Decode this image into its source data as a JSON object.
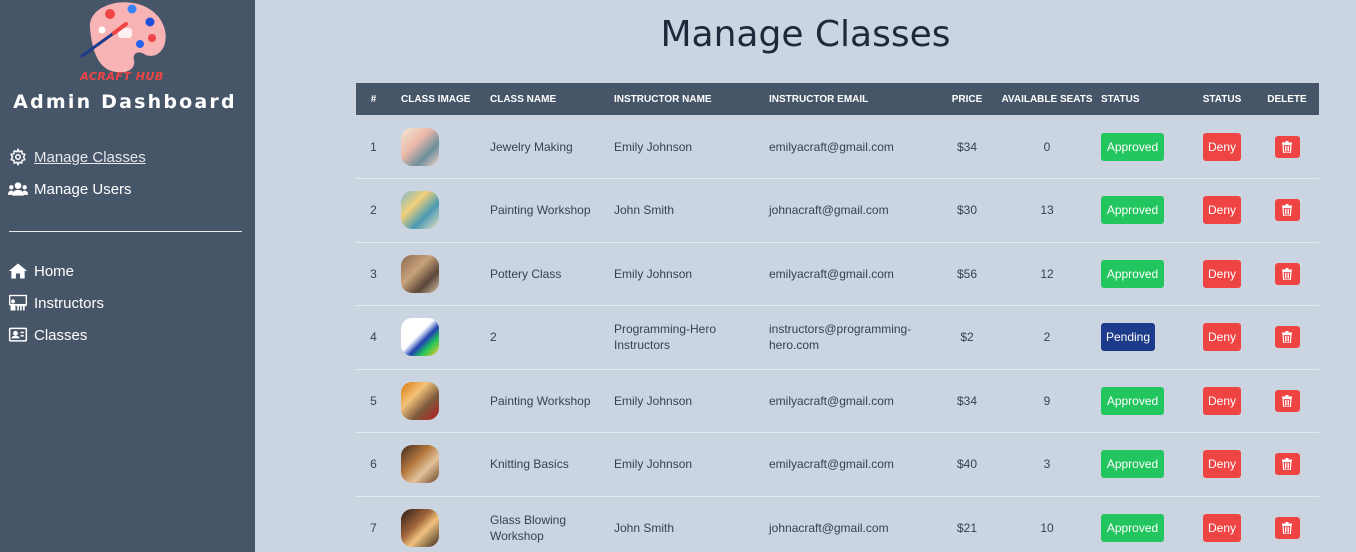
{
  "sidebar": {
    "logo_text": "ACRAFT HUB",
    "title": "Admin Dashboard",
    "primary_nav": [
      {
        "label": "Manage Classes",
        "icon": "gear-icon",
        "active": true
      },
      {
        "label": "Manage Users",
        "icon": "users-icon",
        "active": false
      }
    ],
    "secondary_nav": [
      {
        "label": "Home",
        "icon": "home-icon"
      },
      {
        "label": "Instructors",
        "icon": "instructors-icon"
      },
      {
        "label": "Classes",
        "icon": "classes-icon"
      }
    ]
  },
  "main": {
    "title": "Manage Classes",
    "table": {
      "headers": {
        "num": "#",
        "image": "CLASS IMAGE",
        "name": "CLASS NAME",
        "instructor": "INSTRUCTOR NAME",
        "email": "INSTRUCTOR EMAIL",
        "price": "PRICE",
        "seats": "AVAILABLE SEATS",
        "status": "STATUS",
        "status2": "STATUS",
        "delete": "DELETE"
      },
      "deny_label": "Deny",
      "rows": [
        {
          "num": "1",
          "name": "Jewelry Making",
          "instructor": "Emily Johnson",
          "email": "emilyacraft@gmail.com",
          "price": "$34",
          "seats": "0",
          "status": "Approved"
        },
        {
          "num": "2",
          "name": "Painting Workshop",
          "instructor": "John Smith",
          "email": "johnacraft@gmail.com",
          "price": "$30",
          "seats": "13",
          "status": "Approved"
        },
        {
          "num": "3",
          "name": "Pottery Class",
          "instructor": "Emily Johnson",
          "email": "emilyacraft@gmail.com",
          "price": "$56",
          "seats": "12",
          "status": "Approved"
        },
        {
          "num": "4",
          "name": "2",
          "instructor": "Programming-Hero Instructors",
          "email": "instructors@programming-hero.com",
          "price": "$2",
          "seats": "2",
          "status": "Pending"
        },
        {
          "num": "5",
          "name": "Painting Workshop",
          "instructor": "Emily Johnson",
          "email": "emilyacraft@gmail.com",
          "price": "$34",
          "seats": "9",
          "status": "Approved"
        },
        {
          "num": "6",
          "name": "Knitting Basics",
          "instructor": "Emily Johnson",
          "email": "emilyacraft@gmail.com",
          "price": "$40",
          "seats": "3",
          "status": "Approved"
        },
        {
          "num": "7",
          "name": "Glass Blowing Workshop",
          "instructor": "John Smith",
          "email": "johnacraft@gmail.com",
          "price": "$21",
          "seats": "10",
          "status": "Approved"
        }
      ]
    }
  },
  "colors": {
    "sidebar_bg": "#475569",
    "page_bg": "#cbd5e1",
    "approved": "#22c55e",
    "pending": "#1e3a8a",
    "deny": "#ef4444"
  }
}
